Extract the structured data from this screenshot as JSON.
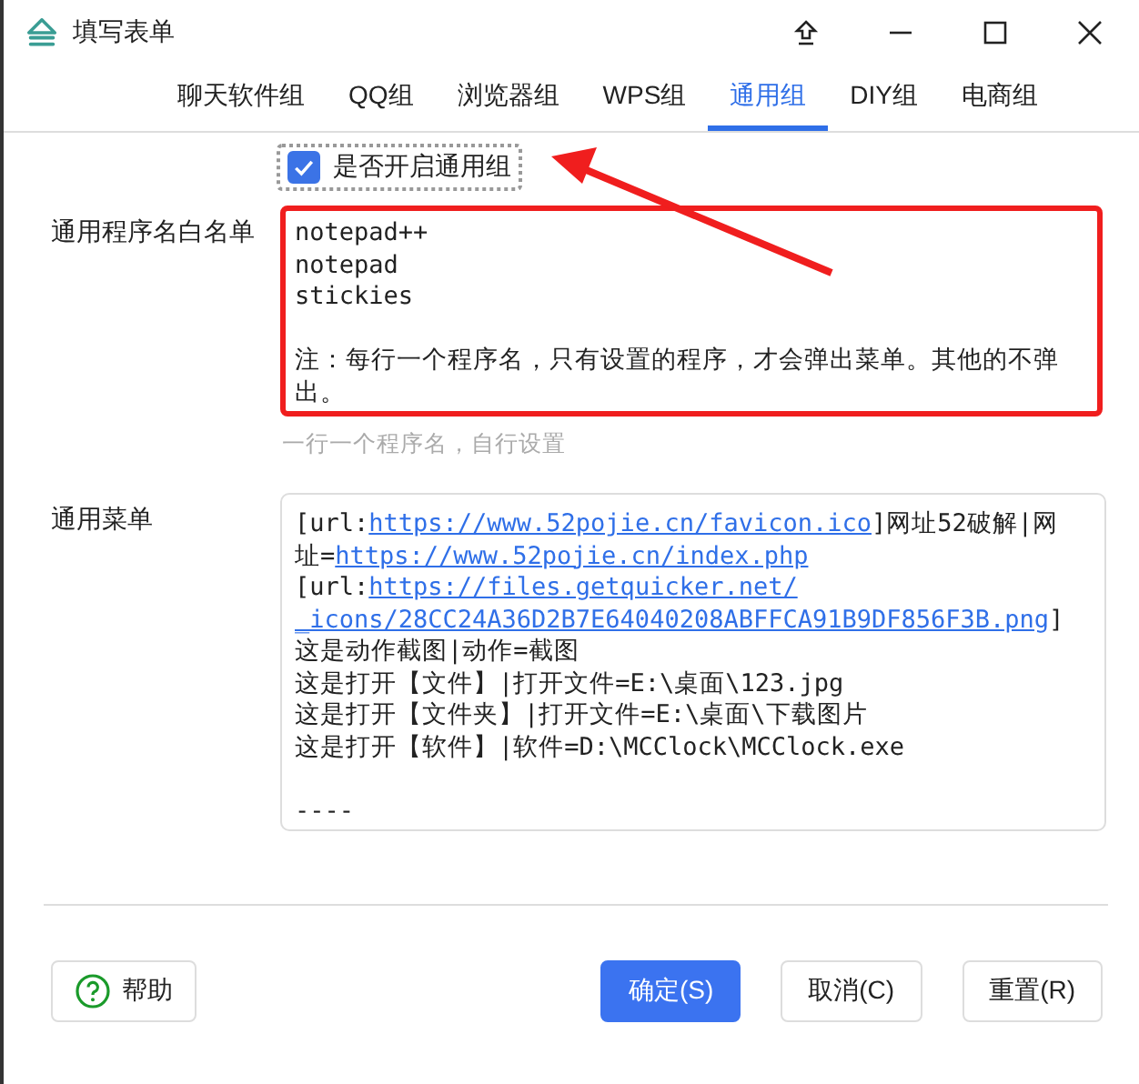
{
  "window": {
    "title": "填写表单"
  },
  "tabs": [
    {
      "label": "聊天软件组",
      "selected": false
    },
    {
      "label": "QQ组",
      "selected": false
    },
    {
      "label": "浏览器组",
      "selected": false
    },
    {
      "label": "WPS组",
      "selected": false
    },
    {
      "label": "通用组",
      "selected": true
    },
    {
      "label": "DIY组",
      "selected": false
    },
    {
      "label": "电商组",
      "selected": false
    }
  ],
  "enable": {
    "label": "是否开启通用组",
    "checked": true
  },
  "whitelist": {
    "label": "通用程序名白名单",
    "value": "notepad++\nnotepad\nstickies\n\n注：每行一个程序名，只有设置的程序，才会弹出菜单。其他的不弹出。",
    "hint": "一行一个程序名，自行设置",
    "highlighted": true
  },
  "menu": {
    "label": "通用菜单",
    "lines": [
      {
        "kind": "text",
        "segments": [
          {
            "kind": "plain",
            "text": "[url:"
          },
          {
            "kind": "link",
            "text": "https://www.52pojie.cn/favicon.ico"
          },
          {
            "kind": "plain",
            "text": "]网址52破解|网"
          }
        ]
      },
      {
        "kind": "text",
        "segments": [
          {
            "kind": "plain",
            "text": "址="
          },
          {
            "kind": "link",
            "text": "https://www.52pojie.cn/index.php"
          }
        ]
      },
      {
        "kind": "text",
        "segments": [
          {
            "kind": "plain",
            "text": "[url:"
          },
          {
            "kind": "link",
            "text": "https://files.getquicker.net/"
          }
        ]
      },
      {
        "kind": "text",
        "segments": [
          {
            "kind": "link",
            "text": "_icons/28CC24A36D2B7E64040208ABFFCA91B9DF856F3B.png"
          },
          {
            "kind": "plain",
            "text": "]"
          }
        ]
      },
      {
        "kind": "text",
        "segments": [
          {
            "kind": "plain",
            "text": "这是动作截图|动作=截图"
          }
        ]
      },
      {
        "kind": "text",
        "segments": [
          {
            "kind": "plain",
            "text": "这是打开【文件】|打开文件=E:\\桌面\\123.jpg"
          }
        ]
      },
      {
        "kind": "text",
        "segments": [
          {
            "kind": "plain",
            "text": "这是打开【文件夹】|打开文件=E:\\桌面\\下载图片"
          }
        ]
      },
      {
        "kind": "text",
        "segments": [
          {
            "kind": "plain",
            "text": "这是打开【软件】|软件=D:\\MCClock\\MCClock.exe"
          }
        ]
      },
      {
        "kind": "blank"
      },
      {
        "kind": "text",
        "segments": [
          {
            "kind": "plain",
            "text": "----"
          }
        ]
      }
    ]
  },
  "buttons": [
    {
      "kind": "help",
      "label": "帮助"
    },
    {
      "kind": "primary",
      "label": "确定(S)"
    },
    {
      "kind": "normal",
      "label": "取消(C)"
    },
    {
      "kind": "normal",
      "label": "重置(R)"
    }
  ]
}
